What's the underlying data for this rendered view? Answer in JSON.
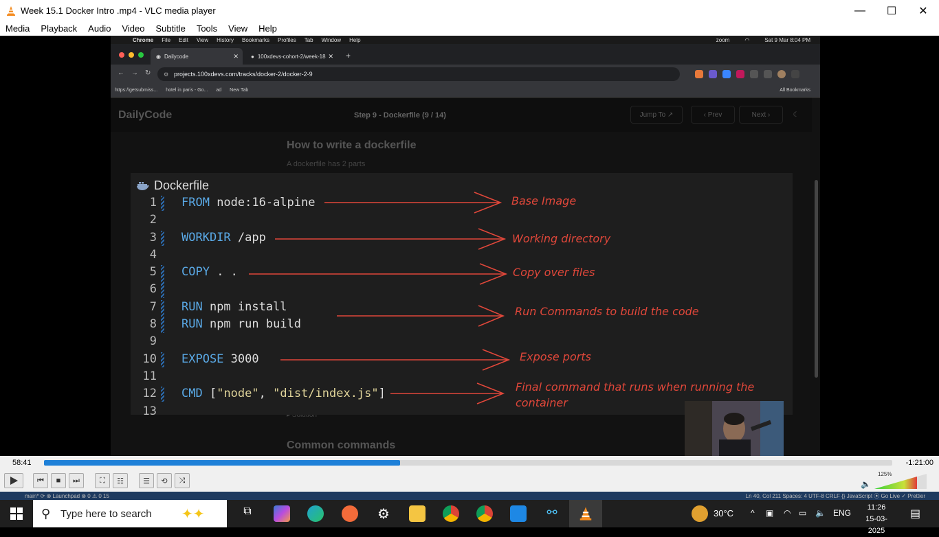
{
  "window": {
    "title": "Week 15.1 Docker Intro .mp4 - VLC media player",
    "controls": [
      "—",
      "☐",
      "✕"
    ]
  },
  "menu": [
    "Media",
    "Playback",
    "Audio",
    "Video",
    "Subtitle",
    "Tools",
    "View",
    "Help"
  ],
  "mac_menubar": {
    "app": "Chrome",
    "items": [
      "File",
      "Edit",
      "View",
      "History",
      "Bookmarks",
      "Profiles",
      "Tab",
      "Window",
      "Help"
    ],
    "zoom": "zoom",
    "datetime": "Sat 9 Mar 8:04 PM"
  },
  "chrome": {
    "tabs": [
      {
        "title": "Dailycode"
      },
      {
        "title": "100xdevs-cohort-2/week-18"
      }
    ],
    "url": "projects.100xdevs.com/tracks/docker-2/docker-2-9",
    "bookmarks": [
      "https://getsubmiss...",
      "hotel in paris - Go...",
      "ad",
      "New Tab"
    ],
    "all_bookmarks": "All Bookmarks"
  },
  "page": {
    "logo": "DailyCode",
    "step": "Step 9 - Dockerfile (9 / 14)",
    "jump": "Jump To ↗",
    "prev": "‹  Prev",
    "next": "Next  ›",
    "title": "How to write a dockerfile",
    "subtitle": "A dockerfile has 2 parts",
    "solution": "▸ Solution",
    "common": "Common commands"
  },
  "code_card": {
    "title": "Dockerfile",
    "line_numbers": [
      "1",
      "2",
      "3",
      "4",
      "5",
      "6",
      "7",
      "8",
      "9",
      "10",
      "11",
      "12",
      "13"
    ],
    "lines": {
      "l1_kw": "FROM",
      "l1_rest": " node:16-alpine",
      "l3_kw": "WORKDIR",
      "l3_rest": " /app",
      "l5_kw": "COPY",
      "l5_rest": " . .",
      "l7_kw": "RUN",
      "l7_rest": " npm install",
      "l8_kw": "RUN",
      "l8_rest": " npm run build",
      "l10_kw": "EXPOSE",
      "l10_rest": " 3000",
      "l12_kw": "CMD",
      "l12_open": " [",
      "l12_s1": "\"node\"",
      "l12_comma": ", ",
      "l12_s2": "\"dist/index.js\"",
      "l12_close": "]"
    },
    "annotations": {
      "a1": "Base Image",
      "a3": "Working directory",
      "a5": "Copy over files",
      "a7": "Run Commands to build the code",
      "a10": "Expose ports",
      "a12_line1": "Final command that runs when running the",
      "a12_line2": "container"
    },
    "annotation_color": "#e0473a",
    "keyword_color": "#5aa9e6"
  },
  "player": {
    "elapsed": "58:41",
    "remaining": "-1:21:00",
    "progress": 0.42,
    "volume": "125%"
  },
  "editor_strip": {
    "left": "main*  ⟳  ⊗  Launchpad  ⊗ 0 ⚠ 0  15",
    "right": "Ln 40, Col 211   Spaces: 4   UTF-8   CRLF   {} JavaScript   ⦿ Go Live   ✓ Prettier"
  },
  "taskbar": {
    "search_placeholder": "Type here to search",
    "weather": "30°C",
    "language": "ENG",
    "time": "11:26",
    "date": "15-03-2025"
  }
}
